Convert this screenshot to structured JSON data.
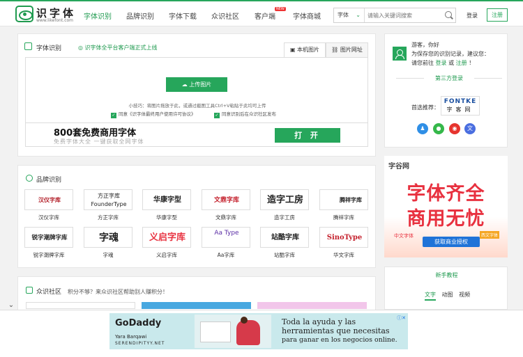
{
  "header": {
    "logo_name": "识字体",
    "logo_url": "www.likefont.com",
    "nav": [
      "字体识别",
      "品牌识别",
      "字体下载",
      "众识社区",
      "客户端",
      "字体商城"
    ],
    "new_badge": "NEW",
    "search_category": "字体",
    "search_placeholder": "请输入关键词搜索",
    "login": "登录",
    "register": "注册"
  },
  "font_recog": {
    "title": "字体识别",
    "subtitle": "识字体全平台客户端正式上线",
    "tab_local": "本机图片",
    "tab_url": "图片网址",
    "upload": "上传图片",
    "tip": "小技巧：将图片拖放于此，或通过截图工具Ctrl+V粘贴于此均可上传",
    "agree1": "同意《识字体最终用户使用许可协议》",
    "agree2": "同意识别后在众识社区发布"
  },
  "promo": {
    "headline": "800套免费商用字体",
    "sub": "免费字体大全 一键获取全网字体",
    "button": "打 开"
  },
  "brand_section": {
    "title": "品牌识别",
    "brands": [
      {
        "logo": "汉仪字库",
        "name": "汉仪字库"
      },
      {
        "logo": "方正字库 FounderType",
        "name": "方正字库"
      },
      {
        "logo": "华康字型",
        "name": "华康字型"
      },
      {
        "logo": "文鼎字库",
        "name": "文鼎字库"
      },
      {
        "logo": "造字工房",
        "name": "造字工房"
      },
      {
        "logo": "腾祥字库",
        "name": "腾祥字库"
      },
      {
        "logo": "锐字潮牌字库",
        "name": "锐字潮牌字库"
      },
      {
        "logo": "字魂",
        "name": "字魂"
      },
      {
        "logo": "义启字库",
        "name": "义启字库"
      },
      {
        "logo": "Aa Type",
        "name": "Aa字库"
      },
      {
        "logo": "站酷字库",
        "name": "站酷字库"
      },
      {
        "logo": "SinoType",
        "name": "华文字库"
      }
    ]
  },
  "community": {
    "title": "众识社区",
    "subtitle": "积分不够？来众识社区帮助别人赚积分！"
  },
  "sidebar": {
    "guest_line1": "游客，你好",
    "guest_line2": "为保存您的识别记录，建议您：",
    "guest_line3_pre": "请您前往",
    "guest_login": "登录",
    "guest_or": "或",
    "guest_register": "注册",
    "guest_end": "！",
    "third_login": "第三方登录",
    "recommend_label": "首选推荐：",
    "fontke_top": "FONTKE",
    "fontke_bottom": "字客网"
  },
  "ad_right": {
    "brand": "字谷网",
    "line1": "字体齐全",
    "line2": "商用无忧",
    "cta": "获取商业授权",
    "tag1": "中文字体",
    "tag2": "西文字体"
  },
  "newbie": {
    "title": "新手教程",
    "tabs": [
      "文字",
      "动图",
      "视频"
    ]
  },
  "bottom_ad": {
    "brand": "GoDaddy",
    "person": "Yara Barqawi",
    "site": "SERENDIPITYY.NET",
    "copy1": "Toda la ayuda y las herramientas que necesitas",
    "copy2": "para ganar en los negocios online."
  },
  "colors": {
    "accent": "#26a65b",
    "link": "#1f9a4f",
    "ad_red": "#e8313f"
  }
}
